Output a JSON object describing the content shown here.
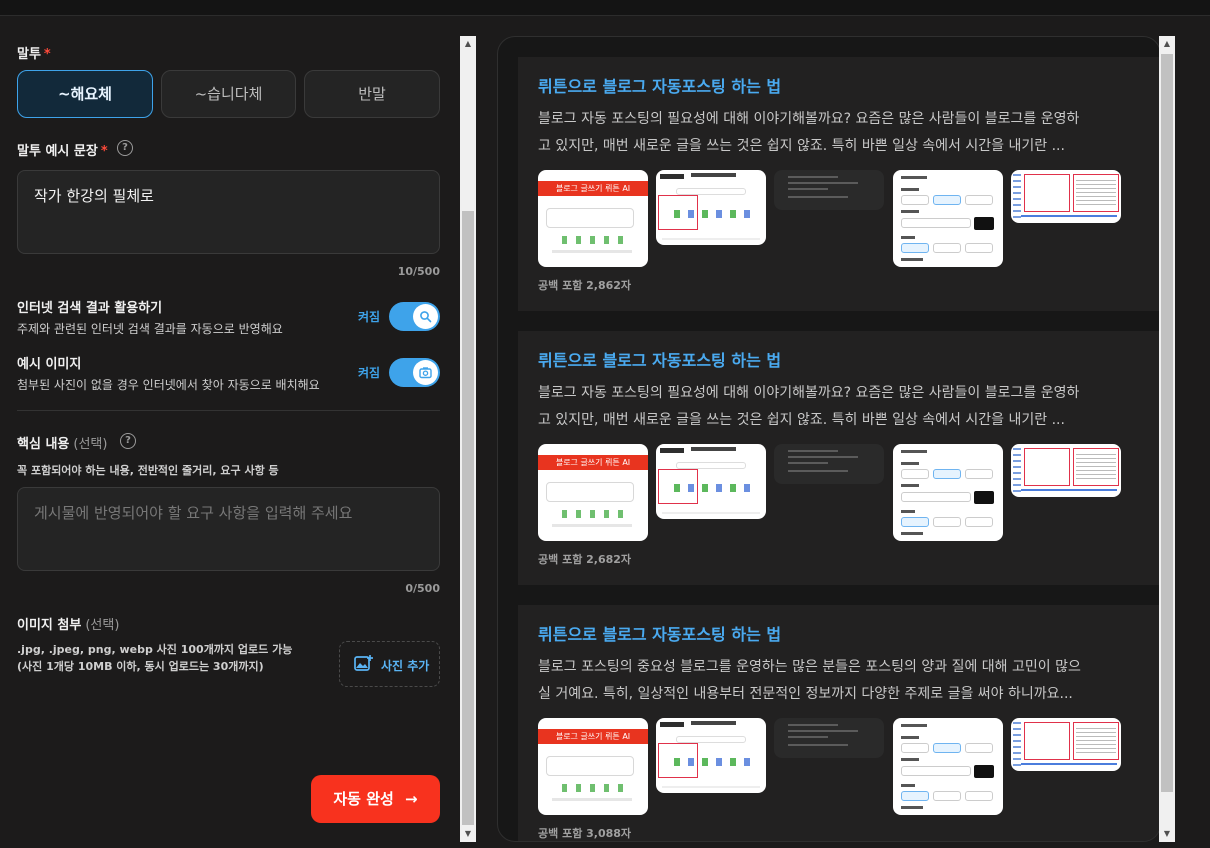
{
  "tone": {
    "label": "말투",
    "required_mark": "*",
    "options": [
      "~해요체",
      "~습니다체",
      "반말"
    ],
    "selected": "~해요체"
  },
  "tone_example": {
    "label": "말투 예시 문장",
    "required_mark": "*",
    "help_icon": "question-circle-icon",
    "value": "작가 한강의 필체로",
    "counter": "10/500"
  },
  "internet_search": {
    "title": "인터넷 검색 결과 활용하기",
    "description": "주제와 관련된 인터넷 검색 결과를 자동으로 반영해요",
    "state_label": "켜짐",
    "enabled": true,
    "icon": "search-icon"
  },
  "example_image": {
    "title": "예시 이미지",
    "description": "첨부된 사진이 없을 경우 인터넷에서 찾아 자동으로 배치해요",
    "state_label": "켜짐",
    "enabled": true,
    "icon": "camera-icon"
  },
  "key_content": {
    "label": "핵심 내용",
    "optional": "(선택)",
    "help_icon": "question-circle-icon",
    "hint": "꼭 포함되어야 하는 내용, 전반적인 줄거리, 요구 사항 등",
    "placeholder": "게시물에 반영되어야 할 요구 사항을 입력해 주세요",
    "counter": "0/500"
  },
  "image_attach": {
    "label": "이미지 첨부",
    "optional": "(선택)",
    "desc_line1": ".jpg, .jpeg, png, webp 사진 100개까지 업로드 가능",
    "desc_line2": "(사진 1개당 10MB 이하, 동시 업로드는 30개까지)",
    "button_label": "사진 추가",
    "button_icon": "image-plus-icon"
  },
  "submit": {
    "label": "자동 완성",
    "arrow": "→"
  },
  "results": [
    {
      "title": "뤼튼으로 블로그 자동포스팅 하는 법",
      "desc_line1": "블로그 자동 포스팅의 필요성에 대해 이야기해볼까요? 요즘은 많은 사람들이 블로그를 운영하",
      "desc_line2": "고 있지만, 매번 새로운 글을 쓰는 것은 쉽지 않죠. 특히 바쁜 일상 속에서 시간을 내기란 ...",
      "count": "공백 포함 2,862자",
      "thumb_banner": "블로그 글쓰기 뤼튼 AI"
    },
    {
      "title": "뤼튼으로 블로그 자동포스팅 하는 법",
      "desc_line1": "블로그 자동 포스팅의 필요성에 대해 이야기해볼까요? 요즘은 많은 사람들이 블로그를 운영하",
      "desc_line2": "고 있지만, 매번 새로운 글을 쓰는 것은 쉽지 않죠. 특히 바쁜 일상 속에서 시간을 내기란 ...",
      "count": "공백 포함 2,682자",
      "thumb_banner": "블로그 글쓰기 뤼튼 AI"
    },
    {
      "title": "뤼튼으로 블로그 자동포스팅 하는 법",
      "desc_line1": "블로그 포스팅의 중요성 블로그를 운영하는 많은 분들은 포스팅의 양과 질에 대해 고민이 많으",
      "desc_line2": "실 거예요. 특히, 일상적인 내용부터 전문적인 정보까지 다양한 주제로 글을 써야 하니까요...",
      "count": "공백 포함 3,088자",
      "thumb_banner": "블로그 글쓰기 뤼튼 AI"
    }
  ],
  "colors": {
    "accent": "#3ea3ea",
    "submit": "#f8321e",
    "background": "#1c1b1b",
    "card": "#222121"
  }
}
